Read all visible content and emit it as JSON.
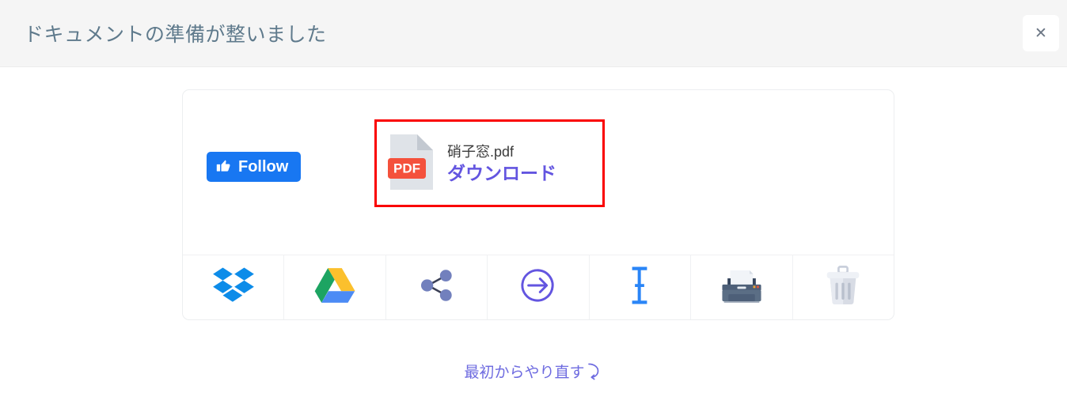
{
  "header": {
    "title": "ドキュメントの準備が整いました",
    "close_label": "✕",
    "close_icon": "close-icon",
    "background": "#f5f5f5",
    "title_color": "#5f7a8c"
  },
  "card": {
    "follow": {
      "label": "Follow",
      "icon": "thumbs-up-icon",
      "color": "#1877f2"
    },
    "download": {
      "file_name": "硝子窓.pdf",
      "link_label": "ダウンロード",
      "file_type_badge": "PDF",
      "icon": "pdf-file-icon",
      "link_color": "#6355e0",
      "badge_color": "#f4513c",
      "highlighted": true,
      "highlight_color": "#fa0000"
    },
    "actions": [
      {
        "name": "dropbox",
        "icon": "dropbox-icon",
        "color": "#0d8ce9"
      },
      {
        "name": "google-drive",
        "icon": "google-drive-icon",
        "color": "#ffc107"
      },
      {
        "name": "share",
        "icon": "share-icon",
        "color": "#7280bd"
      },
      {
        "name": "send",
        "icon": "arrow-right-circle-icon",
        "color": "#6355e0"
      },
      {
        "name": "edit-text",
        "icon": "text-cursor-icon",
        "color": "#2a85f7"
      },
      {
        "name": "print",
        "icon": "printer-icon",
        "color": "#5b6e85"
      },
      {
        "name": "delete",
        "icon": "trash-icon",
        "color": "#d8dce5"
      }
    ]
  },
  "footer": {
    "restart_label": "最初からやり直す",
    "restart_icon": "rotate-arrow-icon",
    "restart_color": "#6e6be0"
  }
}
